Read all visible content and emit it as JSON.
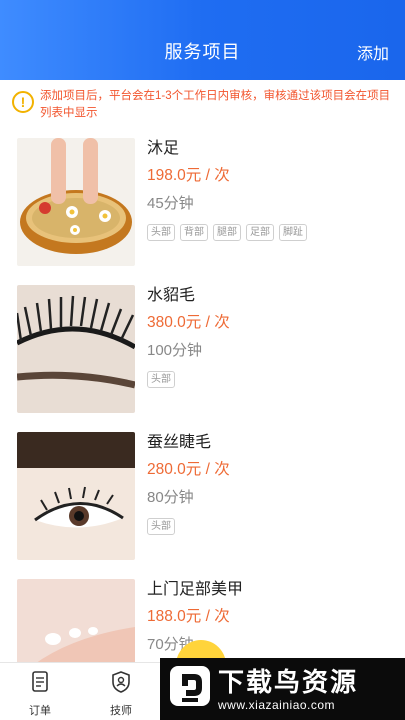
{
  "header": {
    "title": "服务项目",
    "add_label": "添加"
  },
  "notice": {
    "icon": "exclamation-icon",
    "text": "添加项目后，平台会在1-3个工作日内审核，审核通过该项目会在项目列表中显示"
  },
  "services": [
    {
      "name": "沐足",
      "price": "198.0元 / 次",
      "duration": "45分钟",
      "tags": [
        "头部",
        "背部",
        "腿部",
        "足部",
        "脚趾"
      ]
    },
    {
      "name": "水貂毛",
      "price": "380.0元 / 次",
      "duration": "100分钟",
      "tags": [
        "头部"
      ]
    },
    {
      "name": "蚕丝睫毛",
      "price": "280.0元 / 次",
      "duration": "80分钟",
      "tags": [
        "头部"
      ]
    },
    {
      "name": "上门足部美甲",
      "price": "188.0元 / 次",
      "duration": "70分钟",
      "tags": []
    }
  ],
  "tabbar": {
    "orders_label": "订单",
    "technician_label": "技师"
  },
  "watermark": {
    "title": "下载鸟资源",
    "url": "www.xiazainiao.com"
  },
  "colors": {
    "header_blue": "#1f6df2",
    "price_orange": "#ee6a35",
    "notice_red": "#f2552e",
    "fab_yellow": "#ffd43b"
  }
}
